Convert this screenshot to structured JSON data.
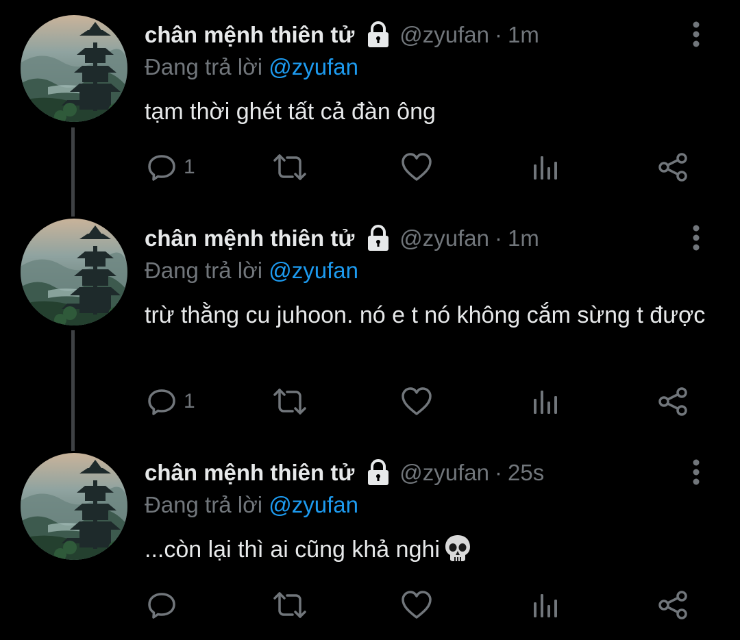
{
  "thread": {
    "tweets": [
      {
        "display_name": "chân mệnh thiên tử",
        "handle": "@zyufan",
        "separator": "·",
        "time": "1m",
        "reply_prefix": "Đang trả lời",
        "reply_to": "@zyufan",
        "text": "tạm thời ghét tất cả đàn ông",
        "reply_count": "1"
      },
      {
        "display_name": "chân mệnh thiên tử",
        "handle": "@zyufan",
        "separator": "·",
        "time": "1m",
        "reply_prefix": "Đang trả lời",
        "reply_to": "@zyufan",
        "text": "trừ thằng cu juhoon. nó e t nó không cắm sừng t được",
        "reply_count": "1"
      },
      {
        "display_name": "chân mệnh thiên tử",
        "handle": "@zyufan",
        "separator": "·",
        "time": "25s",
        "reply_prefix": "Đang trả lời",
        "reply_to": "@zyufan",
        "text": "...còn lại thì ai cũng khả nghi",
        "emoji": "skull-icon",
        "reply_count": ""
      }
    ]
  },
  "icons": {
    "avatar": "pagoda-landscape-avatar",
    "lock": "lock-icon",
    "more": "more-vertical-icon",
    "reply": "reply-icon",
    "retweet": "retweet-icon",
    "like": "heart-icon",
    "views": "views-icon",
    "share": "share-icon"
  },
  "colors": {
    "background": "#000000",
    "text_primary": "#e7e9ea",
    "text_secondary": "#71767b",
    "mention": "#1d9bf0",
    "thread_line": "#3e4144"
  }
}
